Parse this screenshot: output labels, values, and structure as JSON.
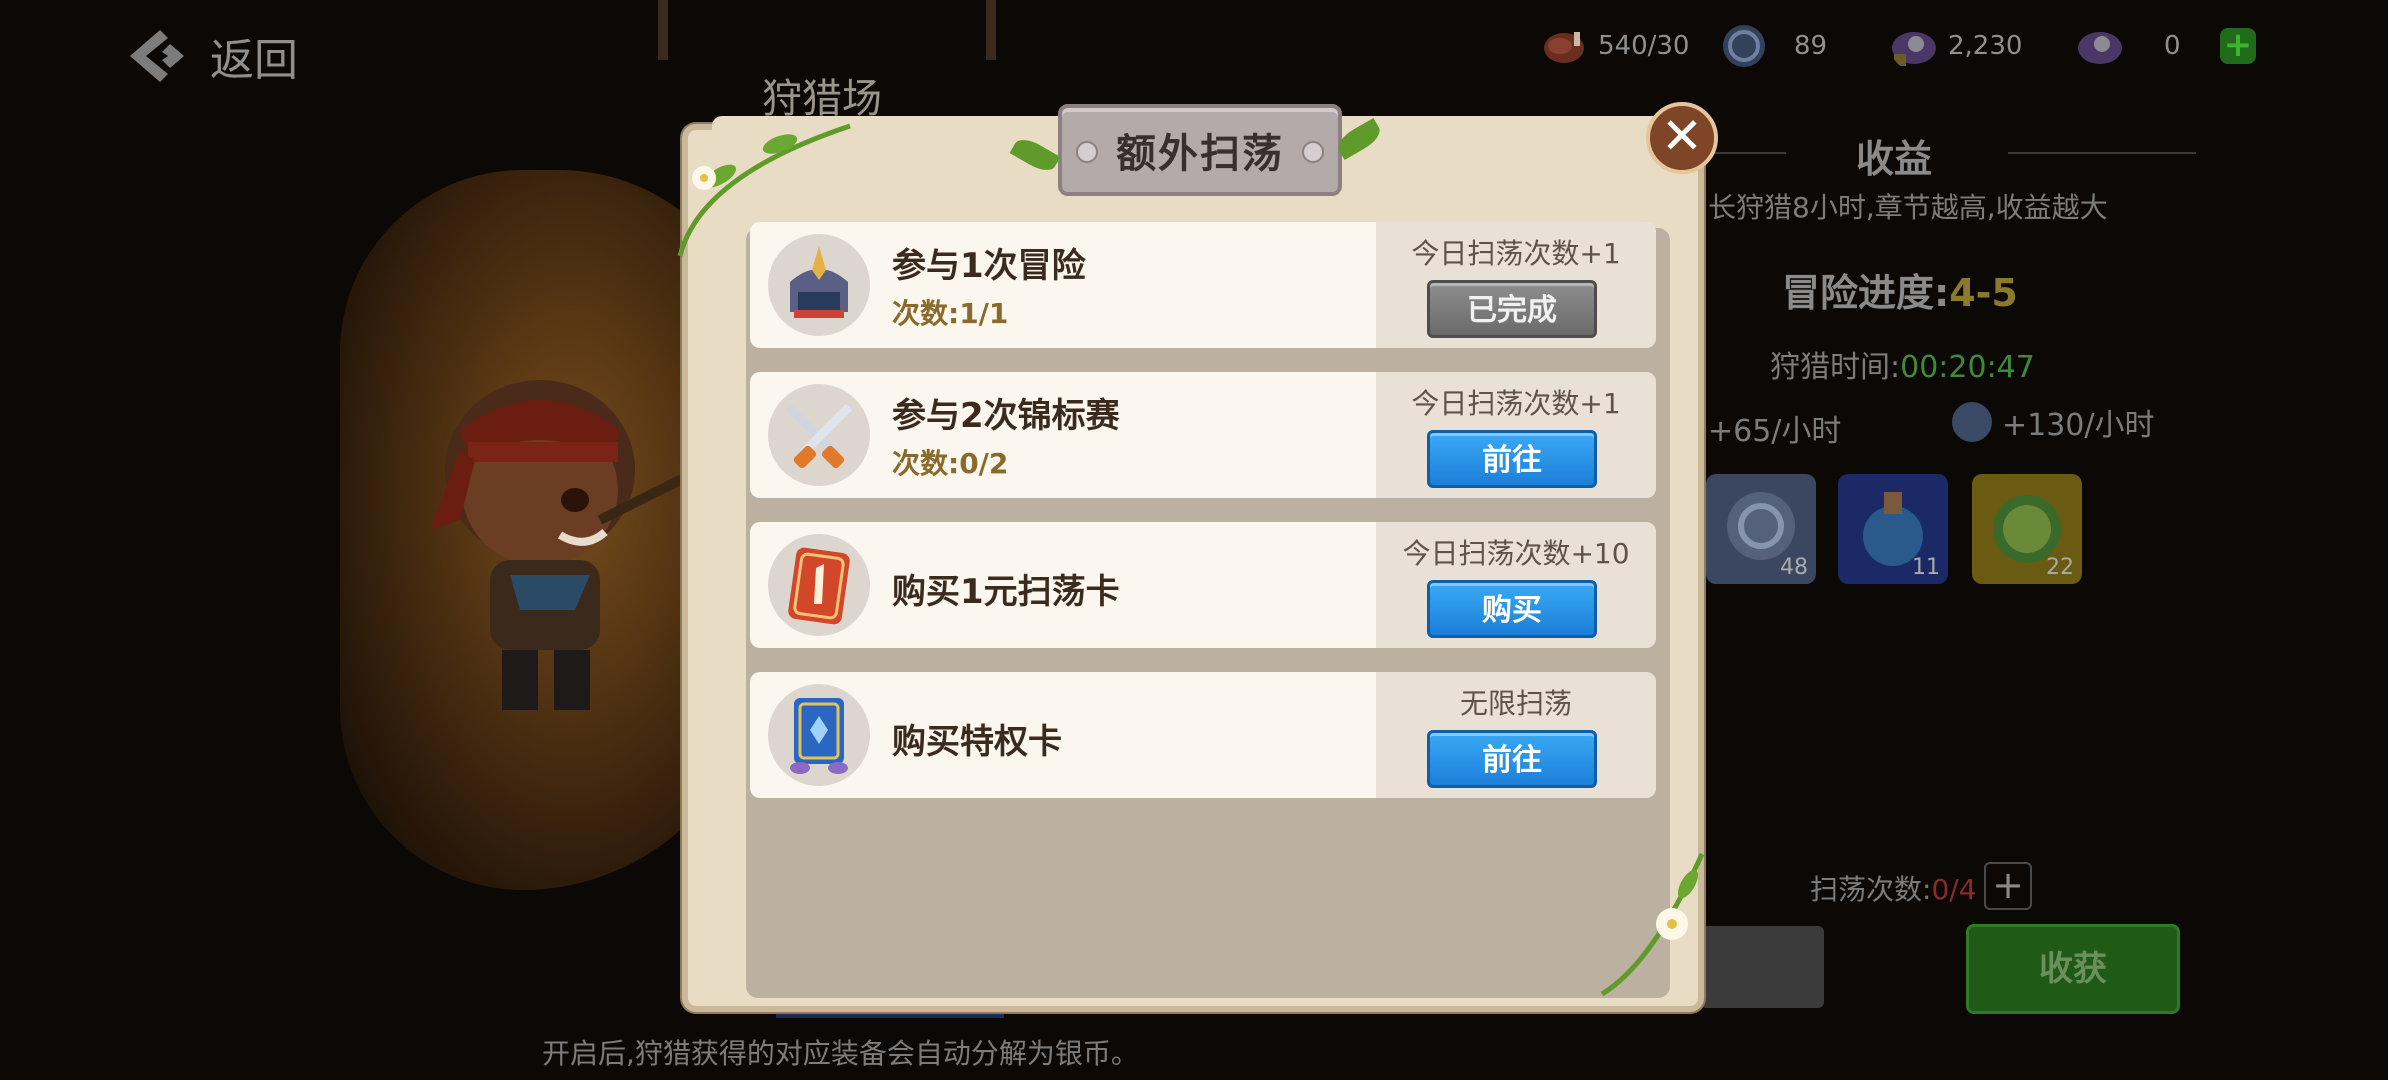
{
  "topbar": {
    "back_label": "返回",
    "scene_title": "狩猎场",
    "resources": [
      {
        "icon": "meat-icon",
        "value": "540/30"
      },
      {
        "icon": "silver-coin-icon",
        "value": "89"
      },
      {
        "icon": "locked-pearl-icon",
        "value": "2,230"
      },
      {
        "icon": "pearl-shell-icon",
        "value": "0"
      }
    ]
  },
  "right_panel": {
    "title": "收益",
    "desc": "长狩猎8小时,章节越高,收益越大",
    "progress_label": "冒险进度:",
    "progress_value": "4-5",
    "time_label": "狩猎时间:",
    "time_value": "00:20:47",
    "rate_1": "+65/小时",
    "rate_2": "+130/小时",
    "items": [
      {
        "icon": "silver-coin-icon",
        "count": "48"
      },
      {
        "icon": "potion-icon",
        "count": "11"
      },
      {
        "icon": "exp-icon",
        "count": "22"
      }
    ],
    "sweep_label": "扫荡次数:",
    "sweep_value": "0/4",
    "harvest_label": "收获"
  },
  "bottom_note": "开启后,狩猎获得的对应装备会自动分解为银币。",
  "modal": {
    "title": "额外扫荡",
    "tasks": [
      {
        "icon": "helmet-icon",
        "name": "参与1次冒险",
        "progress": "次数:1/1",
        "reward": "今日扫荡次数+1",
        "button": "已完成",
        "state": "done"
      },
      {
        "icon": "crossed-swords-icon",
        "name": "参与2次锦标赛",
        "progress": "次数:0/2",
        "reward": "今日扫荡次数+1",
        "button": "前往",
        "state": "go"
      },
      {
        "icon": "sweep-card-icon",
        "name": "购买1元扫荡卡",
        "progress": "",
        "reward": "今日扫荡次数+10",
        "button": "购买",
        "state": "buy"
      },
      {
        "icon": "privilege-card-icon",
        "name": "购买特权卡",
        "progress": "",
        "reward": "无限扫荡",
        "button": "前往",
        "state": "go"
      }
    ]
  }
}
